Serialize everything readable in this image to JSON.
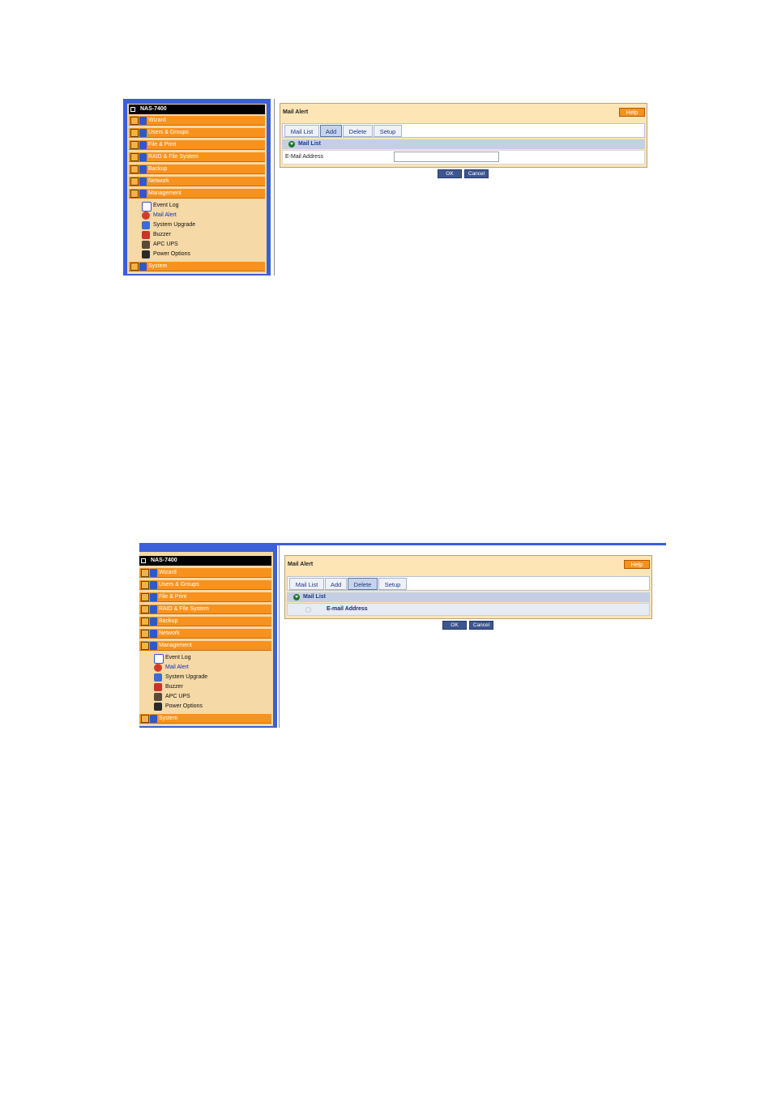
{
  "screenshots": [
    {
      "sidebar": {
        "title": "NAS-7400",
        "categories": [
          "Wizard",
          "Users & Groups",
          "File & Print",
          "RAID & File System",
          "Backup",
          "Network",
          "Management"
        ],
        "management_items": [
          "Event Log",
          "Mail Alert",
          "System Upgrade",
          "Buzzer",
          "APC UPS",
          "Power Options"
        ],
        "active_item": "Mail Alert",
        "footer_category": "System"
      },
      "panel": {
        "title": "Mail Alert",
        "help_label": "Help",
        "tabs": [
          "Mail List",
          "Add",
          "Delete",
          "Setup"
        ],
        "active_tab": "Add",
        "section_title": "Mail List",
        "field_label": "E-Mail Address",
        "field_value": "",
        "ok_label": "OK",
        "cancel_label": "Cancel"
      }
    },
    {
      "sidebar": {
        "title": "NAS-7400",
        "categories": [
          "Wizard",
          "Users & Groups",
          "File & Print",
          "RAID & File System",
          "Backup",
          "Network",
          "Management"
        ],
        "management_items": [
          "Event Log",
          "Mail Alert",
          "System Upgrade",
          "Buzzer",
          "APC UPS",
          "Power Options"
        ],
        "active_item": "Mail Alert",
        "footer_category": "System"
      },
      "panel": {
        "title": "Mail Alert",
        "help_label": "Help",
        "tabs": [
          "Mail List",
          "Add",
          "Delete",
          "Setup"
        ],
        "active_tab": "Delete",
        "section_title": "Mail List",
        "column_header": "E-mail Address",
        "ok_label": "OK",
        "cancel_label": "Cancel"
      }
    }
  ],
  "colors": {
    "sidebar_frame": "#3b5fd8",
    "category_orange": "#f7921e",
    "panel_beige": "#fde5b6",
    "sidebar_cream": "#f5d9a6",
    "tab_active": "#c7d3ea",
    "button_blue": "#3e5690"
  },
  "icons": {
    "category": "folder-plus-icon",
    "section": "green-down-arrow-icon",
    "event_log": "event-log-icon",
    "mail_alert": "mail-alert-icon",
    "system_upgrade": "system-upgrade-icon",
    "buzzer": "buzzer-icon",
    "apc_ups": "apc-ups-icon",
    "power_options": "power-options-icon"
  }
}
